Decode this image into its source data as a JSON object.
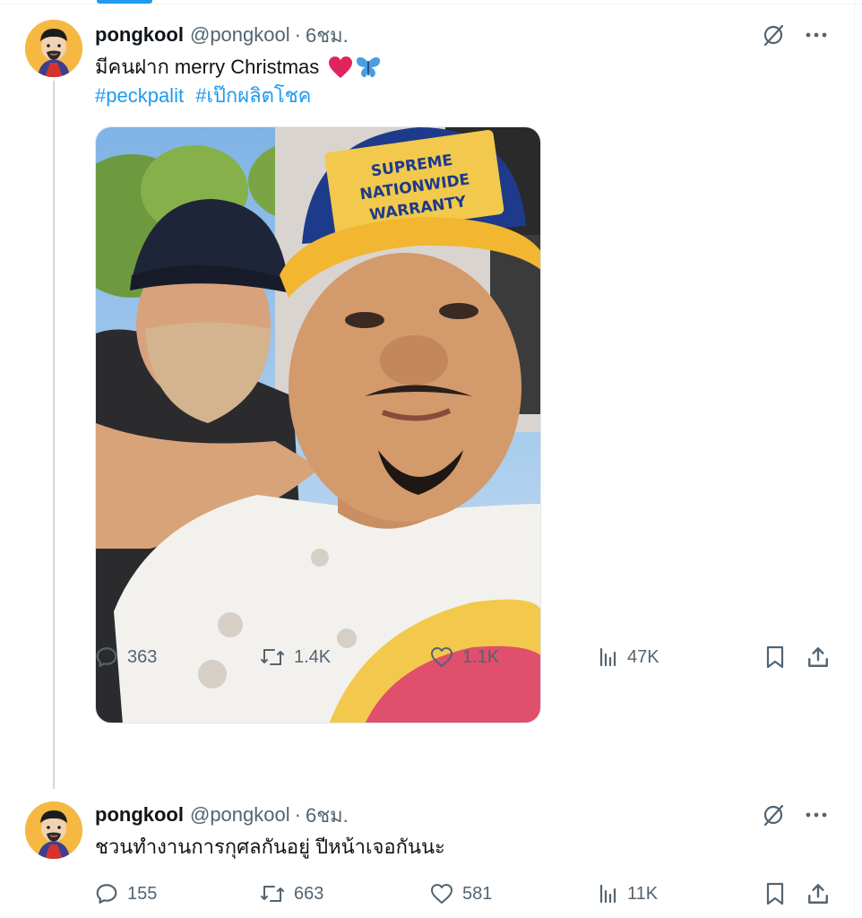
{
  "colors": {
    "accent": "#1d9bf0",
    "muted": "#536471",
    "text": "#0f1419",
    "heart": "#e0245e",
    "butterfly": "#4a9de0"
  },
  "tweets": [
    {
      "name": "pongkool",
      "handle": "@pongkool",
      "separator": "·",
      "time": "6ชม.",
      "text": "มีคนฝาก merry Christmas",
      "emojis": [
        "red-heart",
        "butterfly"
      ],
      "hashtags": [
        "#peckpalit",
        "#เป๊กผลิตโชค"
      ],
      "image": {
        "cap_text": [
          "SUPREME",
          "NATIONWIDE",
          "WARRANTY"
        ]
      },
      "actions": {
        "replies": "363",
        "reposts": "1.4K",
        "likes": "1.1K",
        "views": "47K"
      }
    },
    {
      "name": "pongkool",
      "handle": "@pongkool",
      "separator": "·",
      "time": "6ชม.",
      "text": "ชวนทำงานการกุศลกันอยู่ ปีหน้าเจอกันนะ",
      "actions": {
        "replies": "155",
        "reposts": "663",
        "likes": "581",
        "views": "11K"
      }
    }
  ]
}
